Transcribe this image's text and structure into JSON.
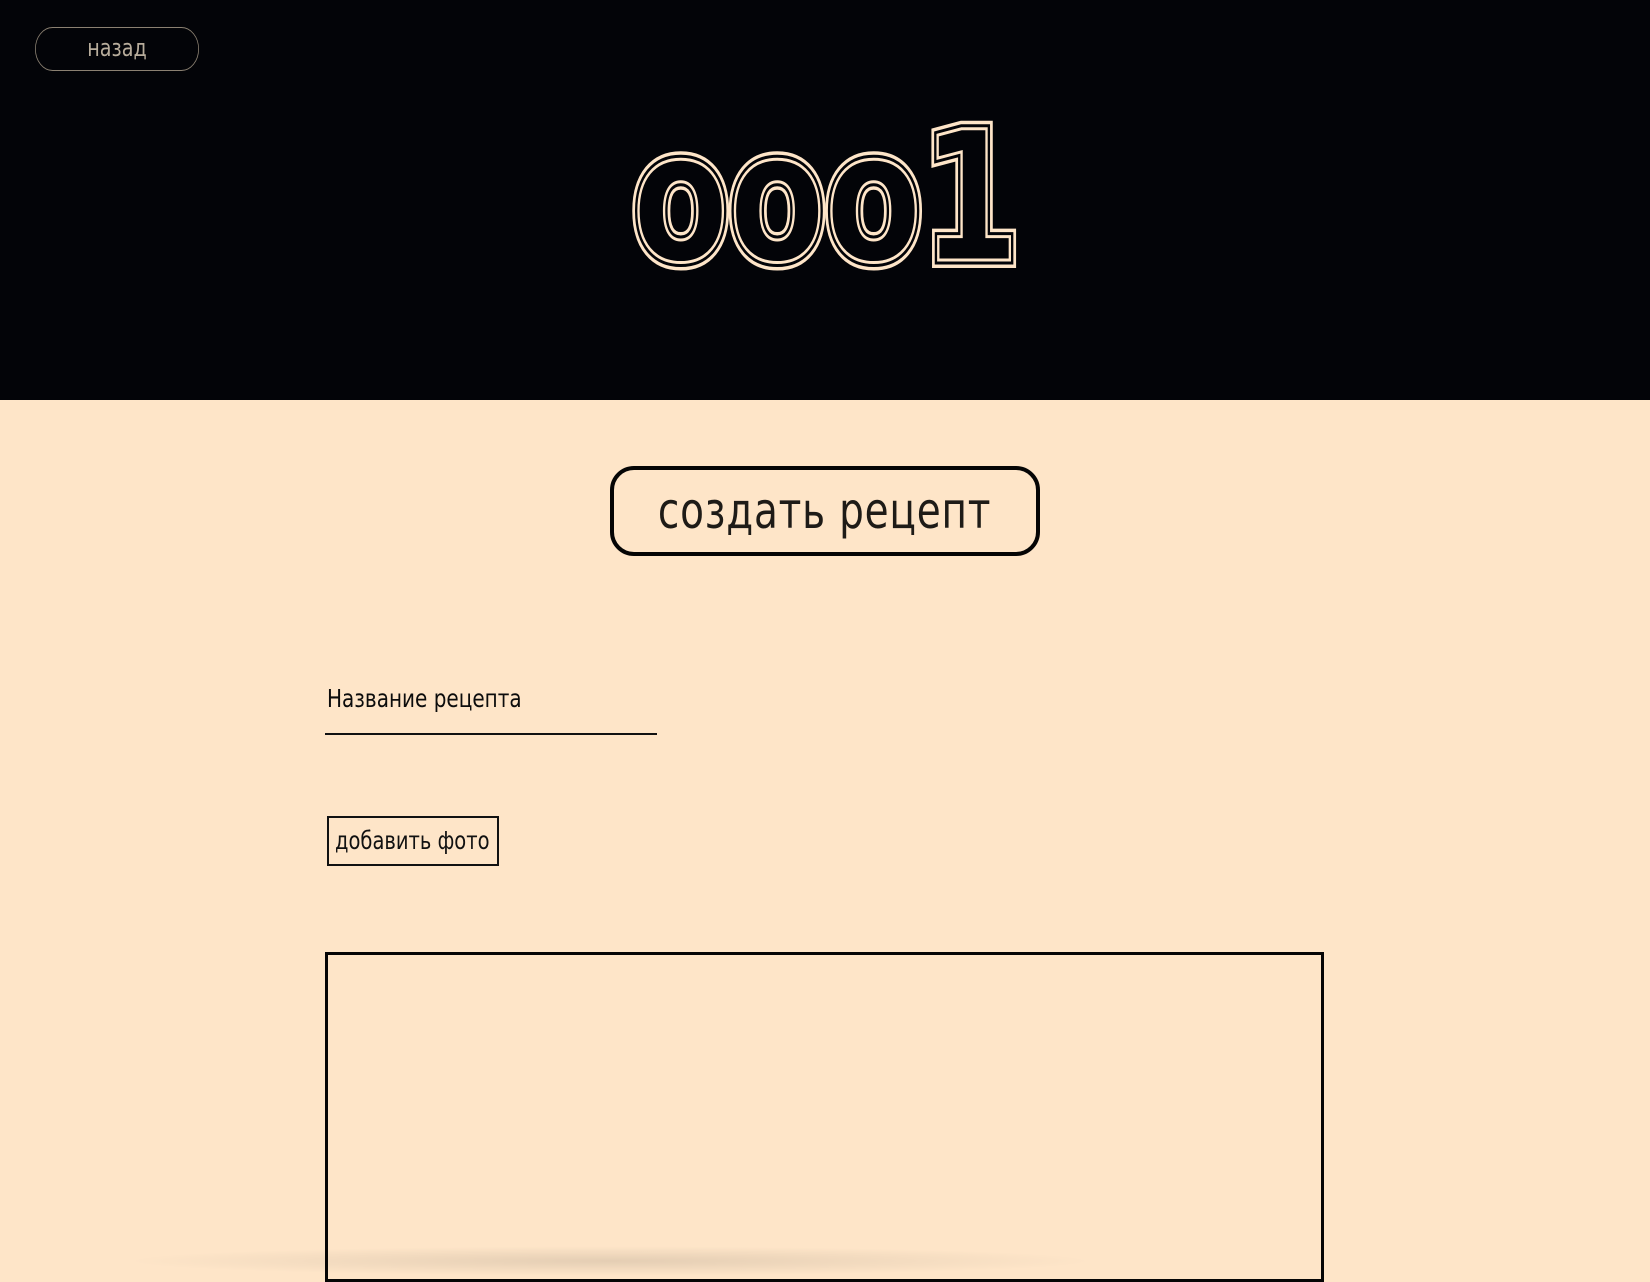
{
  "header": {
    "back_label": "назад",
    "logo_text": "ooo1"
  },
  "main": {
    "create_label": "создать рецепт",
    "title_field_placeholder": "Название рецепта",
    "add_photo_label": "добавить фото"
  },
  "colors": {
    "header_background": "#030408",
    "page_background": "#fee5c8",
    "logo_color": "#fee5c8",
    "border_color": "#050505"
  }
}
